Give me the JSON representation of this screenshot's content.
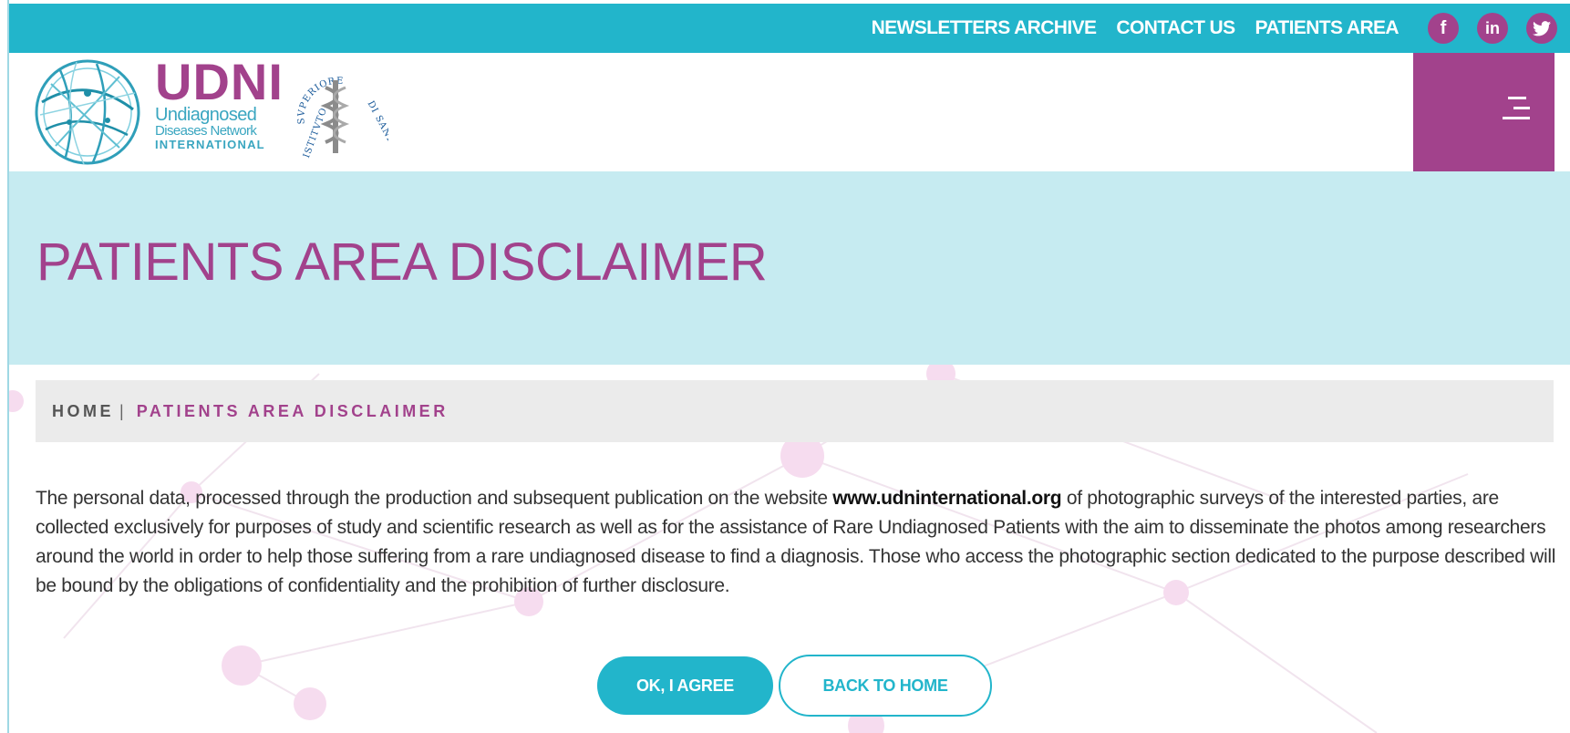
{
  "topbar": {
    "links": [
      "NEWSLETTERS ARCHIVE",
      "CONTACT US",
      "PATIENTS AREA"
    ],
    "socials": [
      {
        "icon": "facebook-icon",
        "glyph": "f"
      },
      {
        "icon": "linkedin-icon",
        "glyph": "in"
      },
      {
        "icon": "twitter-icon",
        "glyph": "’"
      }
    ]
  },
  "logo": {
    "main": "UDNI",
    "line1": "Undiagnosed",
    "line2": "Diseases Network",
    "line3": "INTERNATIONAL",
    "iss_top": "SVPERIORE",
    "iss_left": "ISTITVTO",
    "iss_right": "DI SANITA"
  },
  "hero": {
    "title": "PATIENTS AREA DISCLAIMER"
  },
  "breadcrumb": {
    "home": "HOME",
    "separator": "|",
    "current": "PATIENTS AREA DISCLAIMER"
  },
  "disclaimer": {
    "text_before": "The personal data, processed through the production and subsequent publication on the website ",
    "link": "www.udninternational.org",
    "text_after": " of photographic surveys of the interested parties, are collected exclusively for purposes of study and scientific research as well as for the assistance of Rare Undiagnosed Patients with the aim to disseminate the photos among researchers around the world in order to help those suffering from a rare undiagnosed disease to find a diagnosis. Those who access the photographic section dedicated to the purpose described will be bound by the obligations of confidentiality and the prohibition of further disclosure."
  },
  "buttons": {
    "agree": "OK, I AGREE",
    "back": "BACK TO HOME"
  },
  "colors": {
    "brand_teal": "#22b5cb",
    "brand_purple": "#a2428c",
    "hero_bg": "#c6ebf1",
    "breadcrumb_bg": "#ebebeb"
  }
}
